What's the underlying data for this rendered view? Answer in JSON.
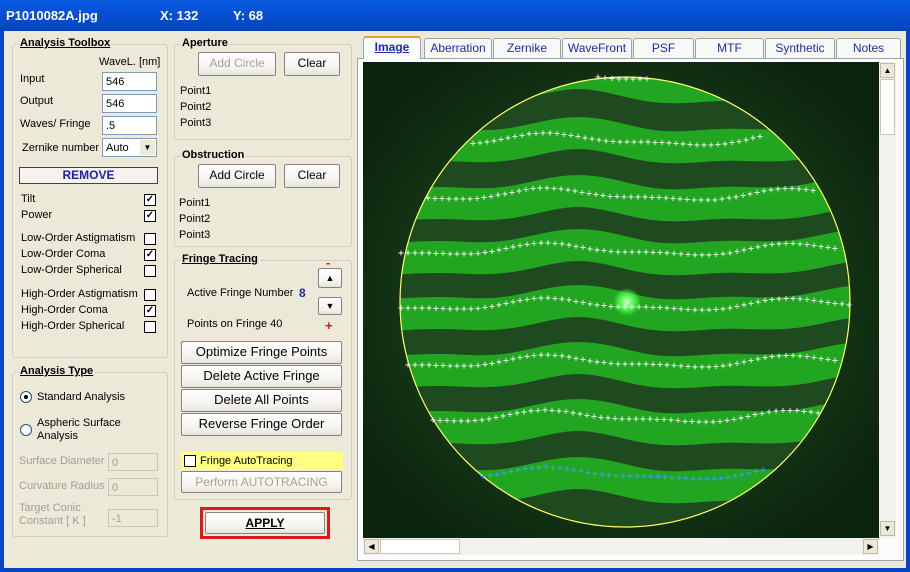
{
  "window": {
    "filename": "P1010082A.jpg",
    "coord_x": "X: 132",
    "coord_y": "Y: 68"
  },
  "analysis_toolbox": {
    "title": "Analysis Toolbox",
    "wavel_header": "WaveL. [nm]",
    "input_label": "Input",
    "input_value": "546",
    "output_label": "Output",
    "output_value": "546",
    "waves_label": "Waves/ Fringe",
    "waves_value": ".5",
    "zernike_label": "Zernike number",
    "zernike_value": "Auto",
    "remove_label": "REMOVE",
    "terms": [
      {
        "label": "Tilt",
        "checked": true
      },
      {
        "label": "Power",
        "checked": true
      },
      {
        "label": "Low-Order  Astigmatism",
        "checked": false
      },
      {
        "label": "Low-Order  Coma",
        "checked": true
      },
      {
        "label": "Low-Order  Spherical",
        "checked": false
      },
      {
        "label": "High-Order  Astigmatism",
        "checked": false
      },
      {
        "label": "High-Order  Coma",
        "checked": true
      },
      {
        "label": "High-Order  Spherical",
        "checked": false
      }
    ]
  },
  "analysis_type": {
    "title": "Analysis Type",
    "standard_label": "Standard  Analysis",
    "aspheric_label_1": "Aspheric  Surface",
    "aspheric_label_2": "Analysis",
    "surface_diameter_label": "Surface Diameter",
    "surface_diameter_value": "0",
    "curvature_radius_label": "Curvature Radius",
    "curvature_radius_value": "0",
    "target_conic_label_1": "Target Conic",
    "target_conic_label_2": "Constant [ K ]",
    "target_conic_value": "-1"
  },
  "aperture": {
    "title": "Aperture",
    "add_circle": "Add Circle",
    "clear": "Clear",
    "points": [
      "Point1",
      "Point2",
      "Point3"
    ]
  },
  "obstruction": {
    "title": "Obstruction",
    "add_circle": "Add Circle",
    "clear": "Clear",
    "points": [
      "Point1",
      "Point2",
      "Point3"
    ]
  },
  "fringe_tracing": {
    "title": "Fringe Tracing",
    "active_fringe_label": "Active Fringe Number",
    "active_fringe_value": "8",
    "points_on_fringe": "Points on  Fringe 40",
    "minus_sign": "-",
    "plus_sign": "+",
    "optimize": "Optimize Fringe Points",
    "delete_active": "Delete Active Fringe",
    "delete_all": "Delete  All  Points",
    "reverse": "Reverse  Fringe Order",
    "autotracing_label": "Fringe AutoTracing",
    "perform_autotracing": "Perform  AUTOTRACING"
  },
  "apply_label": "APPLY",
  "tabs": [
    "Image",
    "Aberration",
    "Zernike",
    "WaveFront",
    "PSF",
    "MTF",
    "Synthetic",
    "Notes"
  ],
  "colors": {
    "titlebar": "#0751d6",
    "fringe_green": "#1bb41b",
    "trace_marker": "#ffffff",
    "active_trace_marker": "#3aa0ff",
    "aperture_circle": "#ffff66",
    "apply_border": "#e01818",
    "autotrace_bg": "#ffff80"
  }
}
